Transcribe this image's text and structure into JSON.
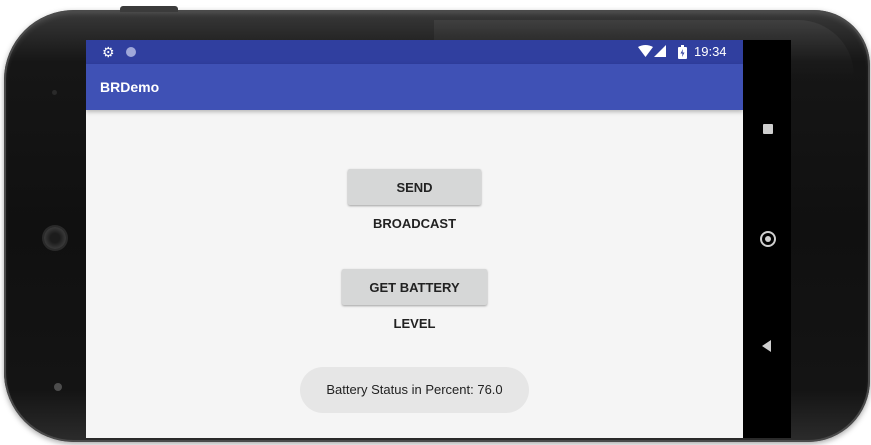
{
  "status_bar": {
    "time": "19:34",
    "icons": [
      "settings-icon",
      "notification-dot-icon",
      "wifi-icon",
      "signal-icon",
      "battery-icon"
    ]
  },
  "app_bar": {
    "title": "BRDemo"
  },
  "main": {
    "send_broadcast_label": "SEND BROADCAST",
    "get_battery_label": "GET BATTERY LEVEL"
  },
  "toast": {
    "text": "Battery Status in Percent: 76.0"
  },
  "nav_bar": {
    "icons": [
      "recent-apps-icon",
      "home-icon",
      "back-icon"
    ]
  },
  "colors": {
    "primary": "#3f51b5",
    "primary_dark": "#303f9f",
    "button": "#d6d7d7",
    "background": "#f5f5f5",
    "toast": "#e6e6e6"
  }
}
